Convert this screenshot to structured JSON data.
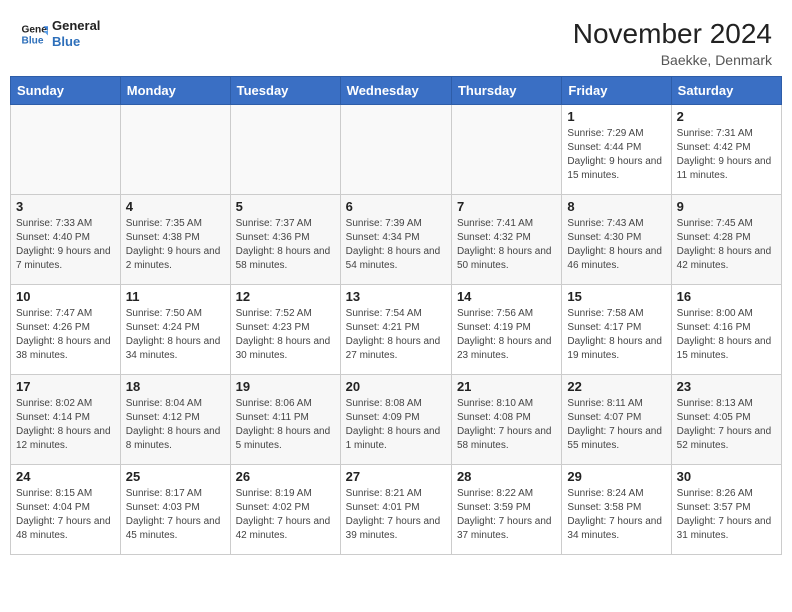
{
  "header": {
    "logo_line1": "General",
    "logo_line2": "Blue",
    "month_title": "November 2024",
    "location": "Baekke, Denmark"
  },
  "days_of_week": [
    "Sunday",
    "Monday",
    "Tuesday",
    "Wednesday",
    "Thursday",
    "Friday",
    "Saturday"
  ],
  "weeks": [
    [
      {
        "day": "",
        "info": ""
      },
      {
        "day": "",
        "info": ""
      },
      {
        "day": "",
        "info": ""
      },
      {
        "day": "",
        "info": ""
      },
      {
        "day": "",
        "info": ""
      },
      {
        "day": "1",
        "info": "Sunrise: 7:29 AM\nSunset: 4:44 PM\nDaylight: 9 hours and 15 minutes."
      },
      {
        "day": "2",
        "info": "Sunrise: 7:31 AM\nSunset: 4:42 PM\nDaylight: 9 hours and 11 minutes."
      }
    ],
    [
      {
        "day": "3",
        "info": "Sunrise: 7:33 AM\nSunset: 4:40 PM\nDaylight: 9 hours and 7 minutes."
      },
      {
        "day": "4",
        "info": "Sunrise: 7:35 AM\nSunset: 4:38 PM\nDaylight: 9 hours and 2 minutes."
      },
      {
        "day": "5",
        "info": "Sunrise: 7:37 AM\nSunset: 4:36 PM\nDaylight: 8 hours and 58 minutes."
      },
      {
        "day": "6",
        "info": "Sunrise: 7:39 AM\nSunset: 4:34 PM\nDaylight: 8 hours and 54 minutes."
      },
      {
        "day": "7",
        "info": "Sunrise: 7:41 AM\nSunset: 4:32 PM\nDaylight: 8 hours and 50 minutes."
      },
      {
        "day": "8",
        "info": "Sunrise: 7:43 AM\nSunset: 4:30 PM\nDaylight: 8 hours and 46 minutes."
      },
      {
        "day": "9",
        "info": "Sunrise: 7:45 AM\nSunset: 4:28 PM\nDaylight: 8 hours and 42 minutes."
      }
    ],
    [
      {
        "day": "10",
        "info": "Sunrise: 7:47 AM\nSunset: 4:26 PM\nDaylight: 8 hours and 38 minutes."
      },
      {
        "day": "11",
        "info": "Sunrise: 7:50 AM\nSunset: 4:24 PM\nDaylight: 8 hours and 34 minutes."
      },
      {
        "day": "12",
        "info": "Sunrise: 7:52 AM\nSunset: 4:23 PM\nDaylight: 8 hours and 30 minutes."
      },
      {
        "day": "13",
        "info": "Sunrise: 7:54 AM\nSunset: 4:21 PM\nDaylight: 8 hours and 27 minutes."
      },
      {
        "day": "14",
        "info": "Sunrise: 7:56 AM\nSunset: 4:19 PM\nDaylight: 8 hours and 23 minutes."
      },
      {
        "day": "15",
        "info": "Sunrise: 7:58 AM\nSunset: 4:17 PM\nDaylight: 8 hours and 19 minutes."
      },
      {
        "day": "16",
        "info": "Sunrise: 8:00 AM\nSunset: 4:16 PM\nDaylight: 8 hours and 15 minutes."
      }
    ],
    [
      {
        "day": "17",
        "info": "Sunrise: 8:02 AM\nSunset: 4:14 PM\nDaylight: 8 hours and 12 minutes."
      },
      {
        "day": "18",
        "info": "Sunrise: 8:04 AM\nSunset: 4:12 PM\nDaylight: 8 hours and 8 minutes."
      },
      {
        "day": "19",
        "info": "Sunrise: 8:06 AM\nSunset: 4:11 PM\nDaylight: 8 hours and 5 minutes."
      },
      {
        "day": "20",
        "info": "Sunrise: 8:08 AM\nSunset: 4:09 PM\nDaylight: 8 hours and 1 minute."
      },
      {
        "day": "21",
        "info": "Sunrise: 8:10 AM\nSunset: 4:08 PM\nDaylight: 7 hours and 58 minutes."
      },
      {
        "day": "22",
        "info": "Sunrise: 8:11 AM\nSunset: 4:07 PM\nDaylight: 7 hours and 55 minutes."
      },
      {
        "day": "23",
        "info": "Sunrise: 8:13 AM\nSunset: 4:05 PM\nDaylight: 7 hours and 52 minutes."
      }
    ],
    [
      {
        "day": "24",
        "info": "Sunrise: 8:15 AM\nSunset: 4:04 PM\nDaylight: 7 hours and 48 minutes."
      },
      {
        "day": "25",
        "info": "Sunrise: 8:17 AM\nSunset: 4:03 PM\nDaylight: 7 hours and 45 minutes."
      },
      {
        "day": "26",
        "info": "Sunrise: 8:19 AM\nSunset: 4:02 PM\nDaylight: 7 hours and 42 minutes."
      },
      {
        "day": "27",
        "info": "Sunrise: 8:21 AM\nSunset: 4:01 PM\nDaylight: 7 hours and 39 minutes."
      },
      {
        "day": "28",
        "info": "Sunrise: 8:22 AM\nSunset: 3:59 PM\nDaylight: 7 hours and 37 minutes."
      },
      {
        "day": "29",
        "info": "Sunrise: 8:24 AM\nSunset: 3:58 PM\nDaylight: 7 hours and 34 minutes."
      },
      {
        "day": "30",
        "info": "Sunrise: 8:26 AM\nSunset: 3:57 PM\nDaylight: 7 hours and 31 minutes."
      }
    ]
  ]
}
